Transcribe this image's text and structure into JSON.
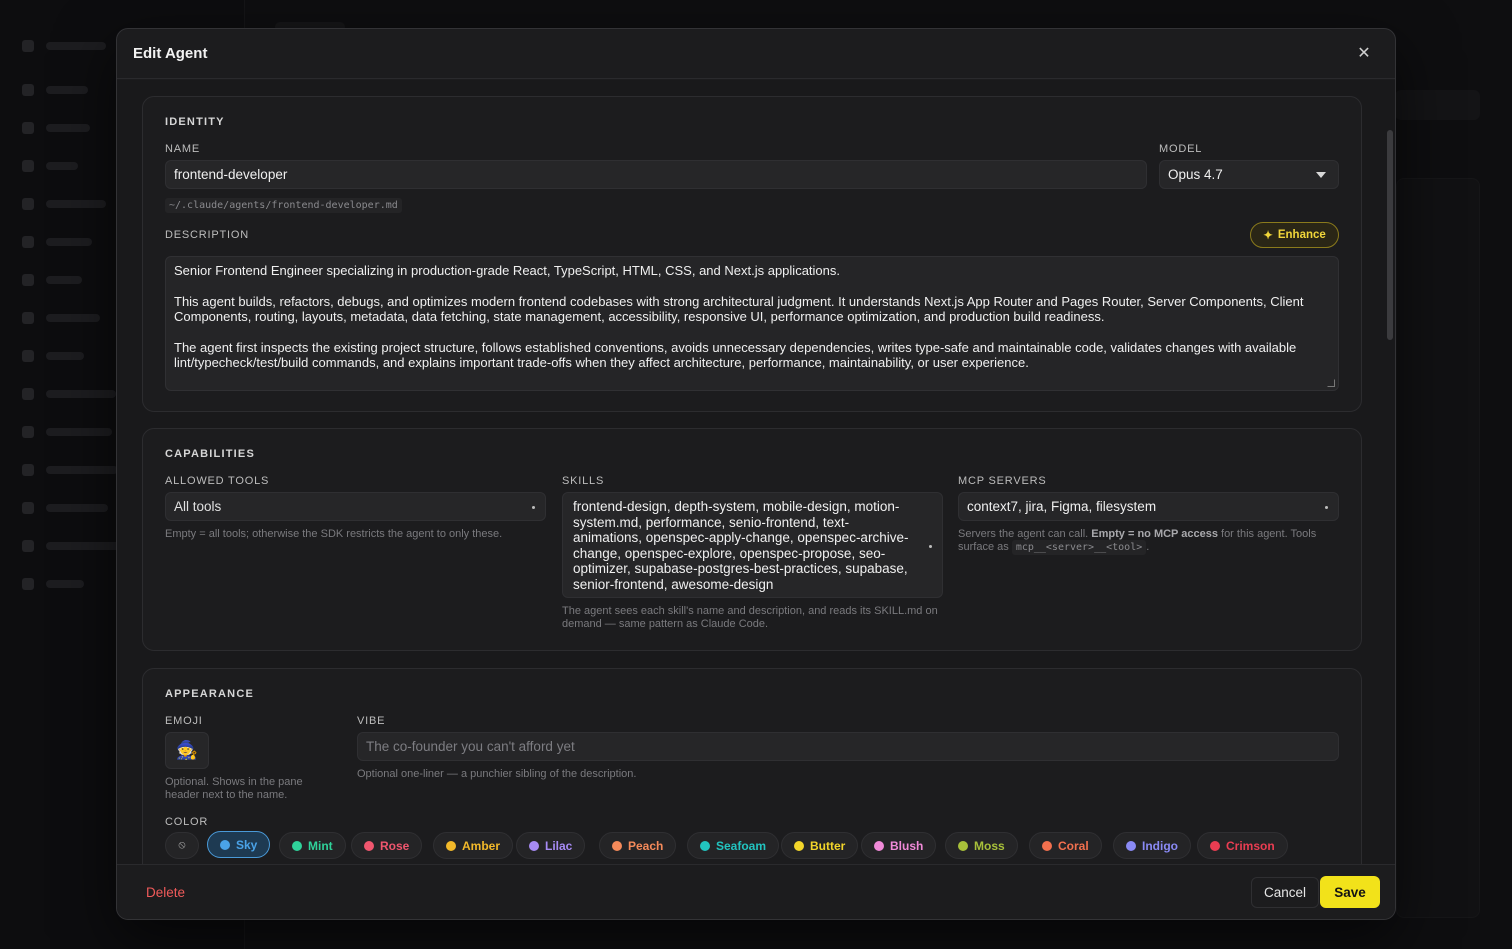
{
  "modal": {
    "title": "Edit Agent",
    "close_icon": "close-icon"
  },
  "identity": {
    "section_title": "IDENTITY",
    "name_label": "NAME",
    "name_value": "frontend-developer",
    "path": "~/.claude/agents/frontend-developer.md",
    "model_label": "MODEL",
    "model_value": "Opus 4.7",
    "description_label": "DESCRIPTION",
    "enhance_label": "Enhance",
    "enhance_icon": "sparkle-icon",
    "description_p1": "Senior Frontend Engineer specializing in production-grade React, TypeScript, HTML, CSS, and Next.js applications.",
    "description_p2": "This agent builds, refactors, debugs, and optimizes modern frontend codebases with strong architectural judgment. It understands Next.js App Router and Pages Router, Server Components, Client Components, routing, layouts, metadata, data fetching, state management, accessibility, responsive UI, performance optimization, and production build readiness.",
    "description_p3": "The agent first inspects the existing project structure, follows established conventions, avoids unnecessary dependencies, writes type-safe and maintainable code, validates changes with available lint/typecheck/test/build commands, and explains important trade-offs when they affect architecture, performance, maintainability, or user experience."
  },
  "capabilities": {
    "section_title": "CAPABILITIES",
    "tools_label": "ALLOWED TOOLS",
    "tools_value": "All tools",
    "tools_hint": "Empty = all tools; otherwise the SDK restricts the agent to only these.",
    "skills_label": "SKILLS",
    "skills_value": "frontend-design, depth-system, mobile-design, motion-system.md, performance, senio-frontend, text-animations, openspec-apply-change, openspec-archive-change, openspec-explore, openspec-propose, seo-optimizer, supabase-postgres-best-practices, supabase, senior-frontend, awesome-design",
    "skills_hint": "The agent sees each skill's name and description, and reads its SKILL.md on demand — same pattern as Claude Code.",
    "mcp_label": "MCP SERVERS",
    "mcp_value": "context7, jira, Figma, filesystem",
    "mcp_hint_a": "Servers the agent can call. ",
    "mcp_hint_b": "Empty = no MCP access",
    "mcp_hint_c": " for this agent. Tools surface as ",
    "mcp_hint_code": "mcp__<server>__<tool>",
    "mcp_hint_d": "."
  },
  "appearance": {
    "section_title": "APPEARANCE",
    "emoji_label": "EMOJI",
    "emoji_value": "🧙",
    "emoji_hint": "Optional. Shows in the pane header next to the name.",
    "vibe_label": "VIBE",
    "vibe_placeholder": "The co-founder you can't afford yet",
    "vibe_hint": "Optional one-liner — a punchier sibling of the description.",
    "color_label": "COLOR",
    "none_symbol": "⦸",
    "colors": [
      {
        "name": "Sky",
        "hex": "#4aa3e8",
        "selected": true
      },
      {
        "name": "Mint",
        "hex": "#2fd39a",
        "selected": false
      },
      {
        "name": "Rose",
        "hex": "#f0566e",
        "selected": false
      },
      {
        "name": "Amber",
        "hex": "#f2b92a",
        "selected": false
      },
      {
        "name": "Lilac",
        "hex": "#a78bf5",
        "selected": false
      },
      {
        "name": "Peach",
        "hex": "#f58a5a",
        "selected": false
      },
      {
        "name": "Seafoam",
        "hex": "#22c4c0",
        "selected": false
      },
      {
        "name": "Butter",
        "hex": "#f2d52a",
        "selected": false
      },
      {
        "name": "Blush",
        "hex": "#f08ad8",
        "selected": false
      },
      {
        "name": "Moss",
        "hex": "#a8c03a",
        "selected": false
      },
      {
        "name": "Coral",
        "hex": "#f2704e",
        "selected": false
      },
      {
        "name": "Indigo",
        "hex": "#8a8af5",
        "selected": false
      },
      {
        "name": "Crimson",
        "hex": "#ea3d52",
        "selected": false
      }
    ]
  },
  "footer": {
    "delete_label": "Delete",
    "cancel_label": "Cancel",
    "save_label": "Save"
  },
  "colors": {
    "accent": "#f2e21a",
    "danger": "#ef5a5a",
    "enhance": "#f1d63a"
  }
}
